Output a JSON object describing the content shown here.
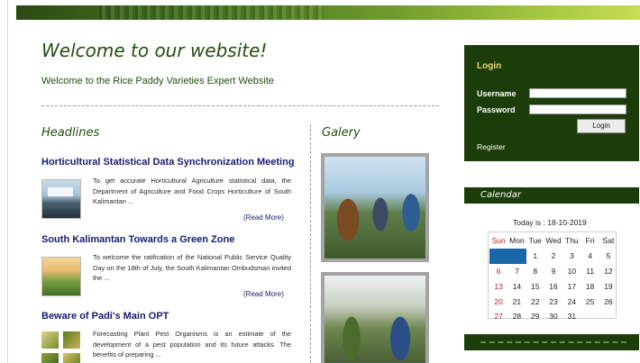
{
  "welcome": {
    "title": "Welcome to our website!",
    "subtitle": "Welcome to the Rice Paddy Varieties Expert Website"
  },
  "headlines": {
    "heading": "Headlines",
    "items": [
      {
        "title": "Horticultural Statistical Data Synchronization Meeting",
        "excerpt": "To get accurate Horticultural Agriculture statistical data, the Department of Agriculture and Food Crops Horticulture of South Kalimantan ...",
        "read_more": "(Read More)"
      },
      {
        "title": "South Kalimantan Towards a Green Zone",
        "excerpt": "To welcome the ratification of the National Public Service Quality Day on the 18th of July, the South Kalimantan Ombudsman invited the ...",
        "read_more": "(Read More)"
      },
      {
        "title": "Beware of Padi's Main OPT",
        "excerpt": "Forecasting Plant Pest Organisms is an estimate of the development of a pest population and its future attacks. The benefits of preparing ...",
        "read_more": ""
      }
    ]
  },
  "gallery": {
    "heading": "Galery"
  },
  "login": {
    "title": "Login",
    "username_label": "Username",
    "username_value": "",
    "password_label": "Password",
    "password_value": "",
    "button_label": "Login",
    "register_label": "Register"
  },
  "calendar": {
    "heading": "Calendar",
    "today_text": "Today is : 18-10-2019",
    "weekdays": [
      "Sun",
      "Mon",
      "Tue",
      "Wed",
      "Thu",
      "Fri",
      "Sat"
    ],
    "weeks": [
      [
        "",
        "",
        "1",
        "2",
        "3",
        "4",
        "5"
      ],
      [
        "6",
        "7",
        "8",
        "9",
        "10",
        "11",
        "12"
      ],
      [
        "13",
        "14",
        "15",
        "16",
        "17",
        "18",
        "19"
      ],
      [
        "20",
        "21",
        "22",
        "23",
        "24",
        "25",
        "26"
      ],
      [
        "27",
        "28",
        "29",
        "30",
        "31",
        "",
        ""
      ]
    ]
  },
  "colors": {
    "dark_green": "#1c3d0a",
    "headline_blue": "#1a1a73",
    "sunday_red": "#c02020",
    "blank_day_blue": "#1a67a8"
  }
}
